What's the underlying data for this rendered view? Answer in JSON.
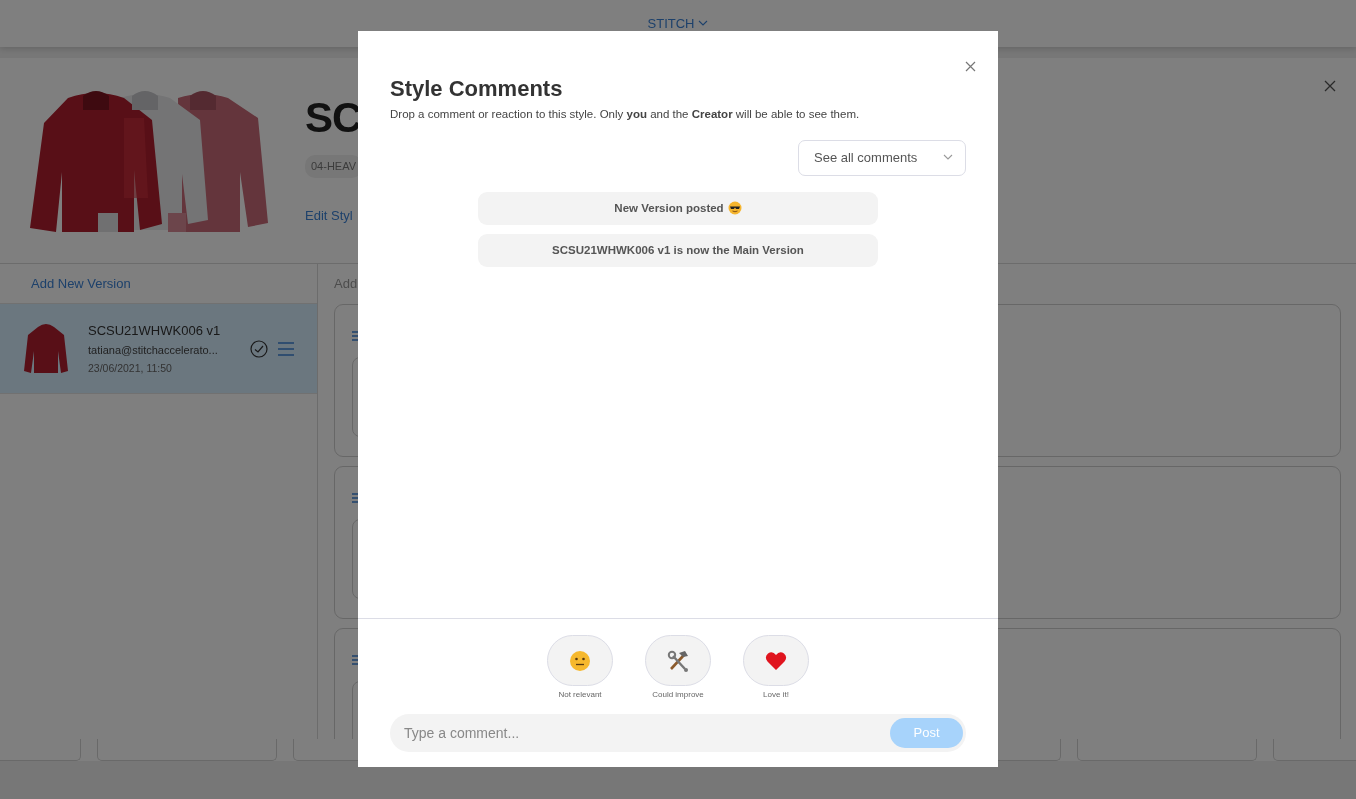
{
  "top_nav": {
    "brand": "STITCH"
  },
  "style_header": {
    "title": "SC",
    "tag": "04-HEAV",
    "edit_link": "Edit Styl"
  },
  "versions_panel": {
    "add_link": "Add New Version",
    "versions": [
      {
        "name": "SCSU21WHWK006 v1",
        "email": "tatiana@stitchaccelerato...",
        "date": "23/06/2021, 11:50",
        "selected": true
      }
    ]
  },
  "content_panel": {
    "add_link": "Add"
  },
  "modal": {
    "title": "Style Comments",
    "subtitle": "Drop a comment or reaction to this style. Only **you** and the **Creator** will be able to see them.",
    "filter": "See all comments",
    "messages": [
      {
        "text": "New Version posted",
        "kind": "with_emoji"
      },
      {
        "text": "SCSU21WHWK006 v1 is now the Main Version",
        "kind": "plain"
      }
    ],
    "reactions": [
      {
        "kind": "neutral",
        "label": "Not relevant"
      },
      {
        "kind": "tools",
        "label": "Could improve"
      },
      {
        "kind": "heart",
        "label": "Love it!"
      }
    ],
    "comment_field": {
      "placeholder": "Type a comment..."
    },
    "post_button": {
      "label": "Post",
      "disabled": true
    }
  }
}
